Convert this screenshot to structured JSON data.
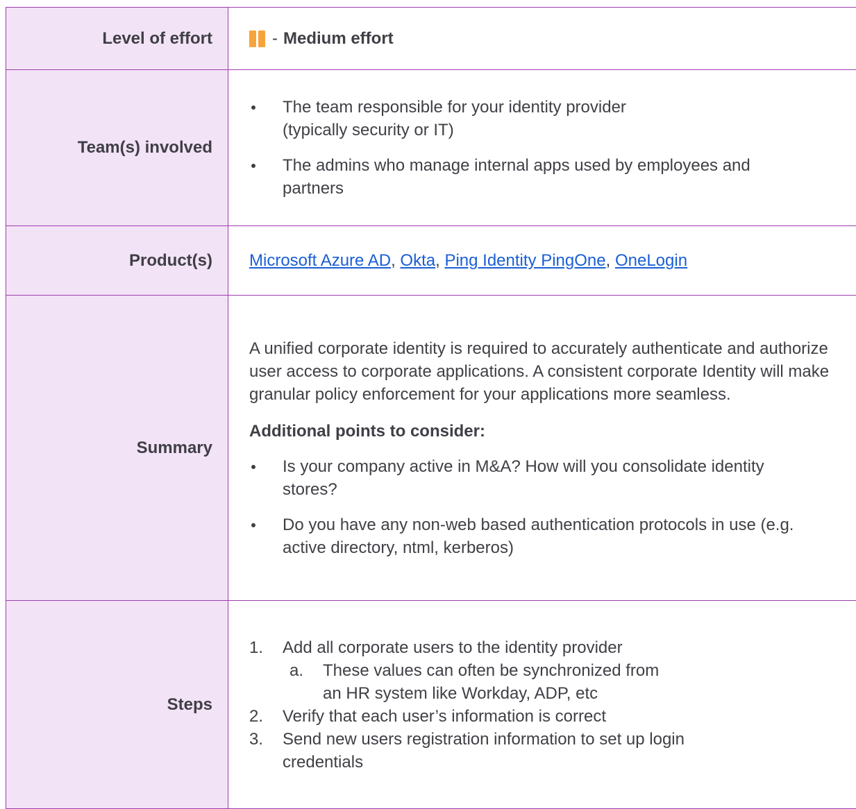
{
  "effort": {
    "label": "Level of effort",
    "separator": "-",
    "value": "Medium effort",
    "icon": "medium-effort-bars-icon",
    "icon_color": "#f6a33b"
  },
  "team": {
    "label": "Team(s) involved",
    "items": [
      "The team responsible for your identity provider (typically security or IT)",
      "The admins who manage internal apps used by employees and partners"
    ]
  },
  "products": {
    "label": "Product(s)",
    "items": [
      "Microsoft Azure AD",
      "Okta",
      "Ping Identity PingOne",
      "OneLogin"
    ],
    "separator": ", "
  },
  "summary": {
    "label": "Summary",
    "text": "A unified corporate identity is required to accurately authenticate and authorize user access to corporate applications. A consistent corporate Identity will make granular policy enforcement for your applications more seamless.",
    "heading": "Additional points to consider:",
    "points": [
      "Is your company active in M&A? How will you consolidate identity stores?",
      "Do you have any non-web based authentication protocols in use (e.g. active directory, ntml, kerberos)"
    ]
  },
  "steps": {
    "label": "Steps",
    "items": [
      {
        "num": "1.",
        "text": "Add all corporate users to the identity provider",
        "sub": [
          {
            "num": "a.",
            "text": "These values can often be synchronized from an HR system like Workday, ADP, etc"
          }
        ]
      },
      {
        "num": "2.",
        "text": "Verify that each user’s information is correct"
      },
      {
        "num": "3.",
        "text": "Send new users registration information to set up login credentials"
      }
    ]
  },
  "colors": {
    "border": "#9c3dae",
    "label_background": "#f3e3f6",
    "link": "#1a5fd6"
  }
}
